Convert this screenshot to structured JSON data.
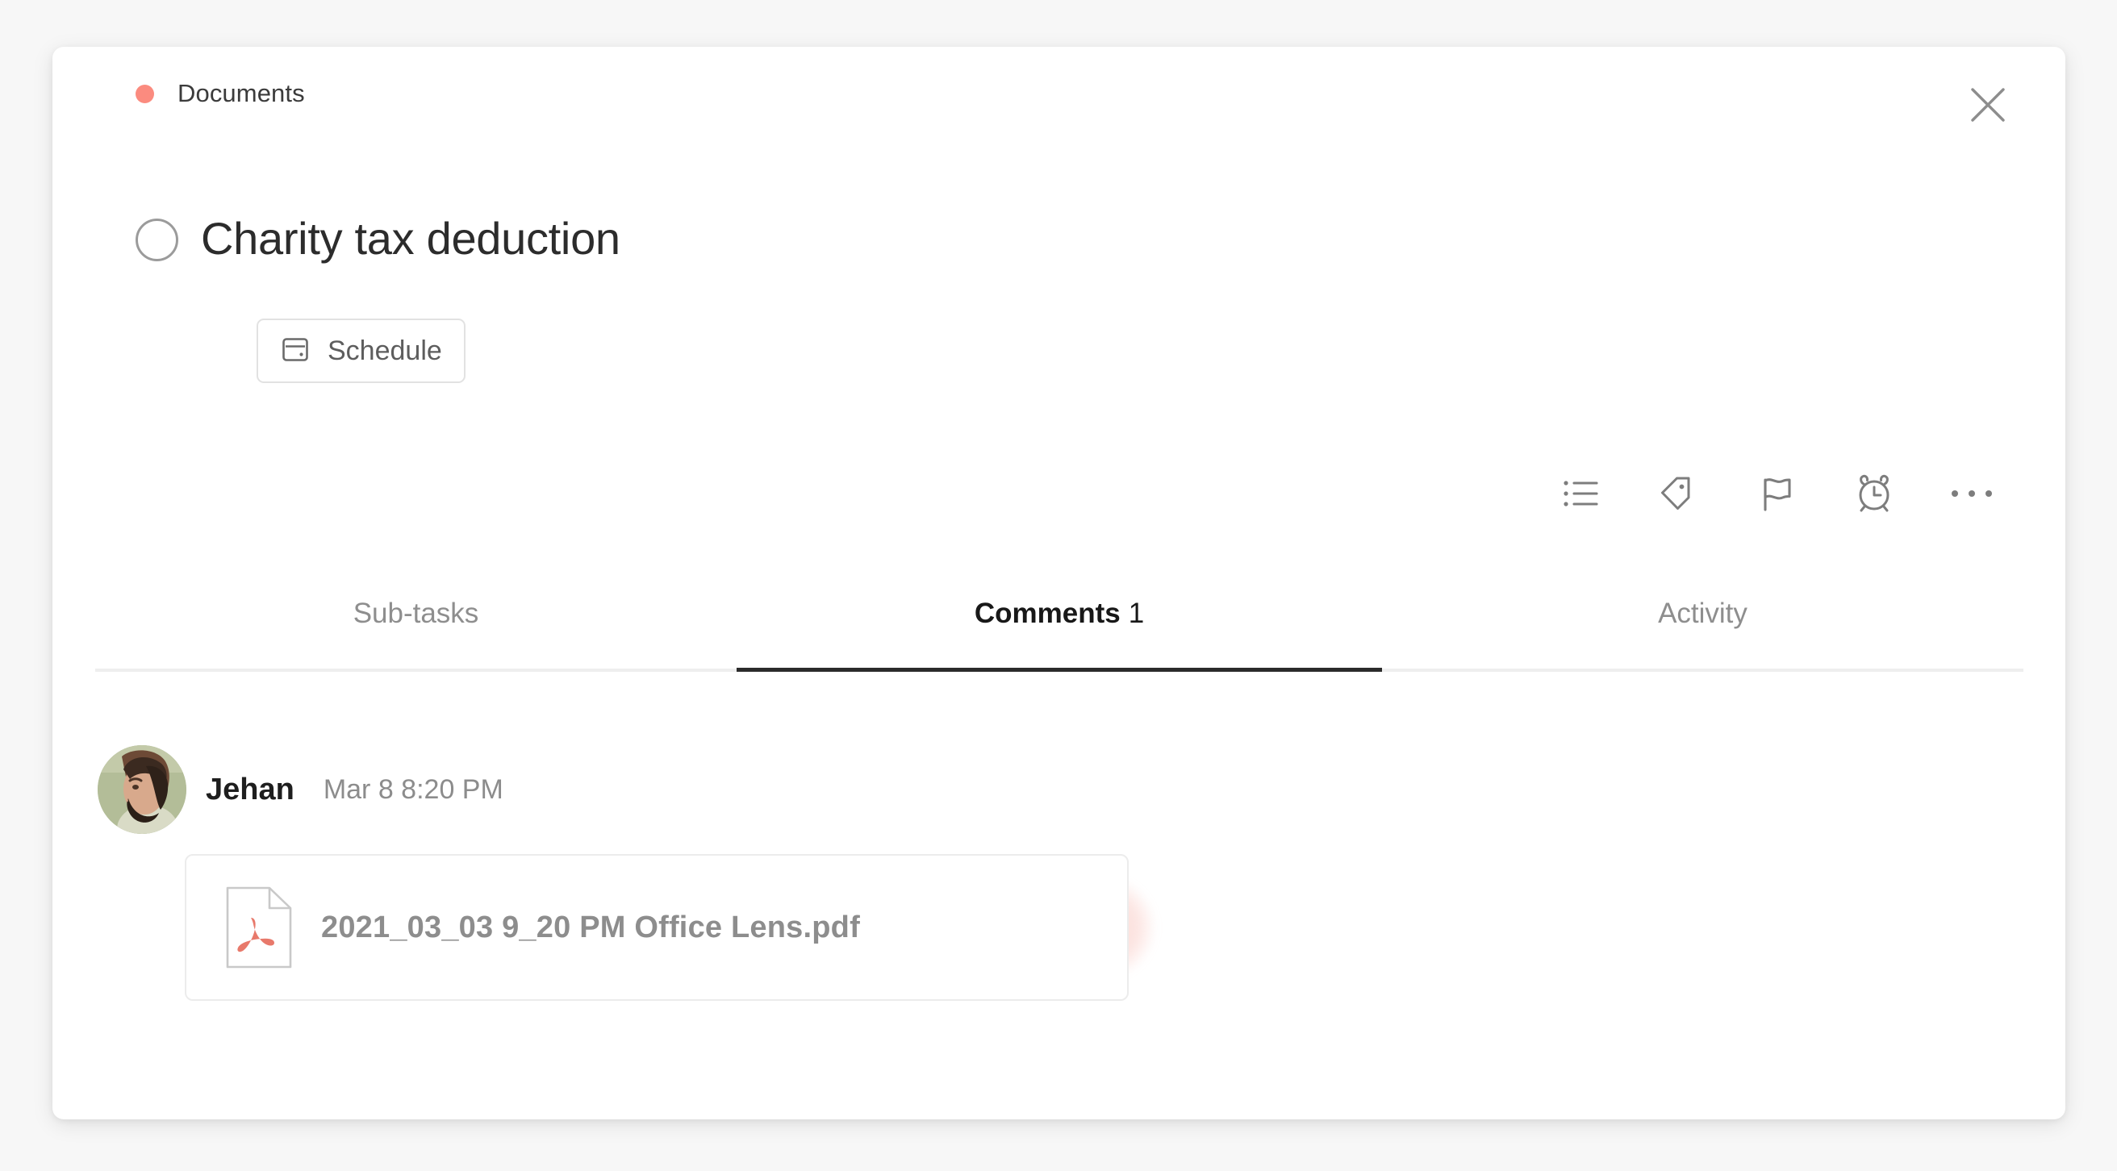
{
  "window": {
    "background_color": "#f7f7f7",
    "card_background": "#ffffff"
  },
  "header": {
    "project_label": "Documents",
    "project_dot_color": "#fb8b7f",
    "close_icon": "close-icon"
  },
  "task": {
    "title": "Charity tax deduction",
    "checkbox_state": "unchecked",
    "schedule_button": {
      "label": "Schedule",
      "icon": "calendar-icon"
    }
  },
  "toolbar": {
    "items": [
      {
        "icon": "bullet-list-icon",
        "name": "subtasks-button"
      },
      {
        "icon": "tag-icon",
        "name": "tag-button"
      },
      {
        "icon": "flag-icon",
        "name": "priority-flag-button"
      },
      {
        "icon": "alarm-clock-icon",
        "name": "reminder-button"
      },
      {
        "icon": "ellipsis-icon",
        "name": "more-options-button"
      }
    ]
  },
  "tabs": [
    {
      "label": "Sub-tasks",
      "count": "",
      "active": false
    },
    {
      "label": "Comments",
      "count": "1",
      "active": true
    },
    {
      "label": "Activity",
      "count": "",
      "active": false
    }
  ],
  "comments": [
    {
      "author": "Jehan",
      "timestamp": "Mar 8 8:20 PM",
      "avatar": "user-avatar-photo",
      "attachment": {
        "filename": "2021_03_03 9_20 PM Office Lens.pdf",
        "icon": "pdf-file-icon",
        "accent_color": "#e8796b"
      }
    }
  ]
}
